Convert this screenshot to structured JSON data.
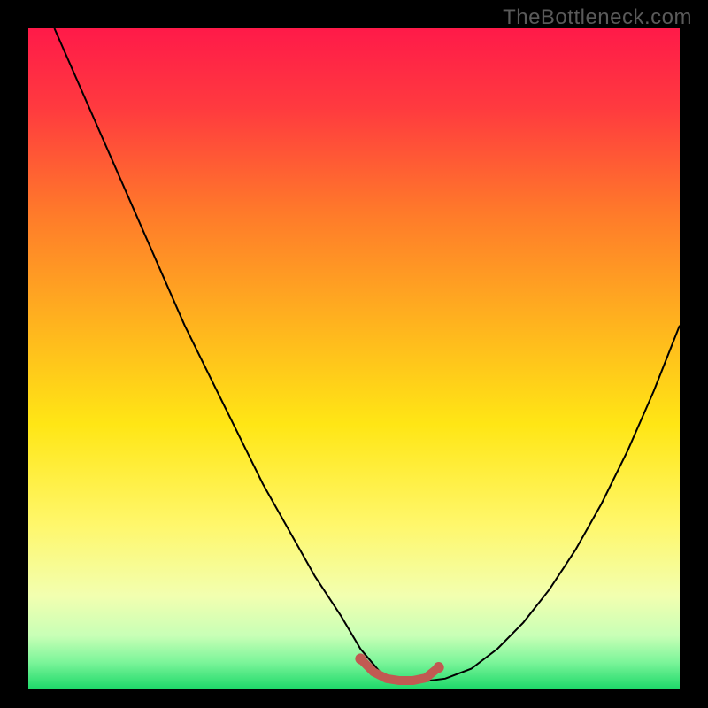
{
  "watermark": "TheBottleneck.com",
  "chart_data": {
    "type": "line",
    "title": "",
    "xlabel": "",
    "ylabel": "",
    "xlim": [
      0,
      100
    ],
    "ylim": [
      0,
      100
    ],
    "grid": false,
    "legend": false,
    "gradient_stops": [
      {
        "offset": 0.0,
        "color": "#ff1a49"
      },
      {
        "offset": 0.12,
        "color": "#ff3a3f"
      },
      {
        "offset": 0.28,
        "color": "#ff7a2a"
      },
      {
        "offset": 0.45,
        "color": "#ffb41e"
      },
      {
        "offset": 0.6,
        "color": "#ffe615"
      },
      {
        "offset": 0.75,
        "color": "#fff76a"
      },
      {
        "offset": 0.86,
        "color": "#f2ffb0"
      },
      {
        "offset": 0.92,
        "color": "#c8ffb6"
      },
      {
        "offset": 0.96,
        "color": "#7cf59a"
      },
      {
        "offset": 1.0,
        "color": "#1fd96a"
      }
    ],
    "series": [
      {
        "name": "bottleneck-curve",
        "color": "#000000",
        "width": 2,
        "x": [
          4,
          8,
          12,
          16,
          20,
          24,
          28,
          32,
          36,
          40,
          44,
          48,
          51,
          54,
          57,
          60,
          64,
          68,
          72,
          76,
          80,
          84,
          88,
          92,
          96,
          100
        ],
        "y": [
          100,
          91,
          82,
          73,
          64,
          55,
          47,
          39,
          31,
          24,
          17,
          11,
          6,
          2.5,
          1,
          1,
          1.5,
          3,
          6,
          10,
          15,
          21,
          28,
          36,
          45,
          55
        ]
      },
      {
        "name": "optimal-zone",
        "color": "#c15a52",
        "width": 10,
        "linecap": "round",
        "x": [
          51,
          53,
          55,
          57,
          59,
          61,
          63
        ],
        "y": [
          4.5,
          2.5,
          1.5,
          1.2,
          1.2,
          1.6,
          3.2
        ]
      }
    ],
    "markers": [
      {
        "x": 51,
        "y": 4.5,
        "r": 6,
        "color": "#c15a52"
      },
      {
        "x": 63,
        "y": 3.2,
        "r": 6,
        "color": "#c15a52"
      }
    ]
  }
}
